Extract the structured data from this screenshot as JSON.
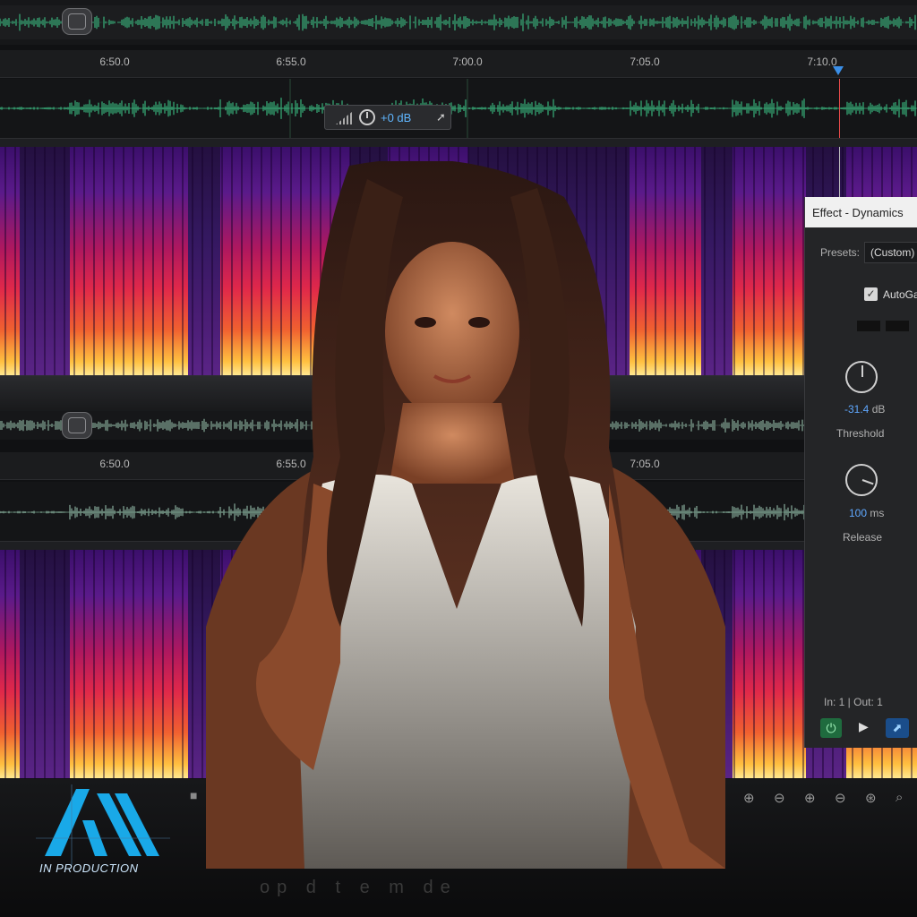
{
  "timeline": {
    "top_ticks": [
      "6:50.0",
      "6:55.0",
      "7:00.0",
      "7:05.0",
      "7:10.0"
    ],
    "bottom_ticks": [
      "6:50.0",
      "6:55.0",
      "7:05.0"
    ]
  },
  "gain_hud": {
    "value": "+0 dB"
  },
  "effect_panel": {
    "title": "Effect - Dynamics",
    "presets_label": "Presets:",
    "presets_value": "(Custom)",
    "autogate_label": "AutoGa",
    "autogate_checked": true,
    "threshold": {
      "value": "-31.4",
      "unit": "dB",
      "label": "Threshold"
    },
    "release": {
      "value": "100",
      "unit": "ms",
      "label": "Release"
    },
    "io_label": "In: 1 | Out: 1"
  },
  "logo": {
    "text": "IN PRODUCTION"
  },
  "caption": {
    "text": "op d      t                    e  m  de"
  },
  "colors": {
    "waveform_top": "#3ecf8e",
    "waveform_bottom": "#9ec9b4",
    "accent_blue": "#5fa8ff",
    "playhead": "#e84a4a",
    "logo_blue": "#19a9e8"
  }
}
